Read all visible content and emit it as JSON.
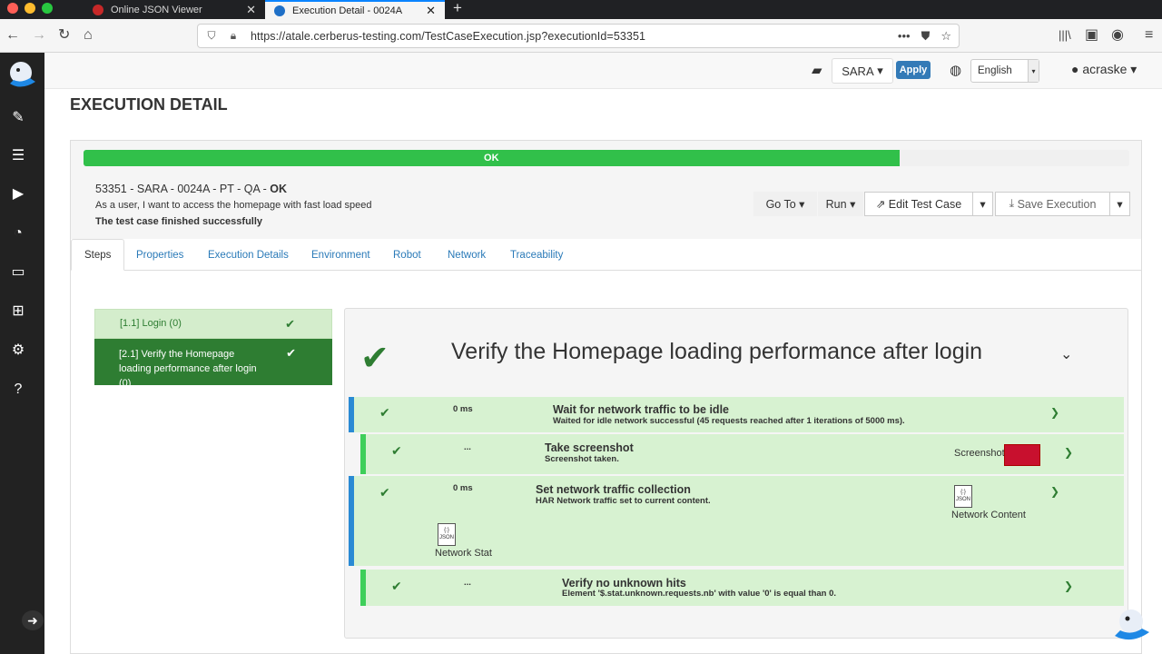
{
  "browser": {
    "tabs": [
      {
        "title": "Online JSON Viewer"
      },
      {
        "title": "Execution Detail - 0024A"
      }
    ],
    "url": "https://atale.cerberus-testing.com/TestCaseExecution.jsp?executionId=53351"
  },
  "header": {
    "system": "SARA",
    "apply_label": "Apply",
    "language": "English",
    "user": "acraske"
  },
  "page": {
    "title": "EXECUTION DETAIL",
    "progress": {
      "label": "OK",
      "percent": 78
    },
    "exec_prefix": "53351 - SARA - 0024A - PT - QA - ",
    "exec_status_code": "OK",
    "description": "As a user, I want to access the homepage with fast load speed",
    "status_message": "The test case finished successfully",
    "buttons": {
      "goto": "Go To",
      "run": "Run",
      "edit": "Edit Test Case",
      "save": "Save Execution"
    },
    "tabs": [
      "Steps",
      "Properties",
      "Execution Details",
      "Environment",
      "Robot",
      "Network",
      "Traceability"
    ]
  },
  "steps": [
    {
      "label": "[1.1] Login (0)"
    },
    {
      "label": "[2.1] Verify the Homepage loading performance after login (0)"
    }
  ],
  "detail": {
    "title": "Verify the Homepage loading performance after login",
    "actions": [
      {
        "time": "0 ms",
        "title": "Wait for network traffic to be idle",
        "sub": "Waited for idle network successful (45 requests reached after 1 iterations of 5000 ms)."
      },
      {
        "time": "...",
        "title": "Take screenshot",
        "sub": "Screenshot taken.",
        "file": "Screenshot"
      },
      {
        "time": "0 ms",
        "title": "Set network traffic collection",
        "sub": "HAR Network traffic set to current content.",
        "file": "Network Content",
        "file2": "Network Stat"
      },
      {
        "time": "...",
        "title": "Verify no unknown hits",
        "sub": "Element '$.stat.unknown.requests.nb' with value '0' is equal than 0."
      }
    ],
    "json_icon_label": "JSON"
  },
  "colors": {
    "progress": "#31c04a",
    "step_active": "#2e7d32",
    "step_inactive": "#d4edcc",
    "action_bg": "#d7f2d1",
    "bar_blue": "#2a8ad4",
    "bar_green": "#3ecf5a",
    "link": "#2a7ab8"
  }
}
